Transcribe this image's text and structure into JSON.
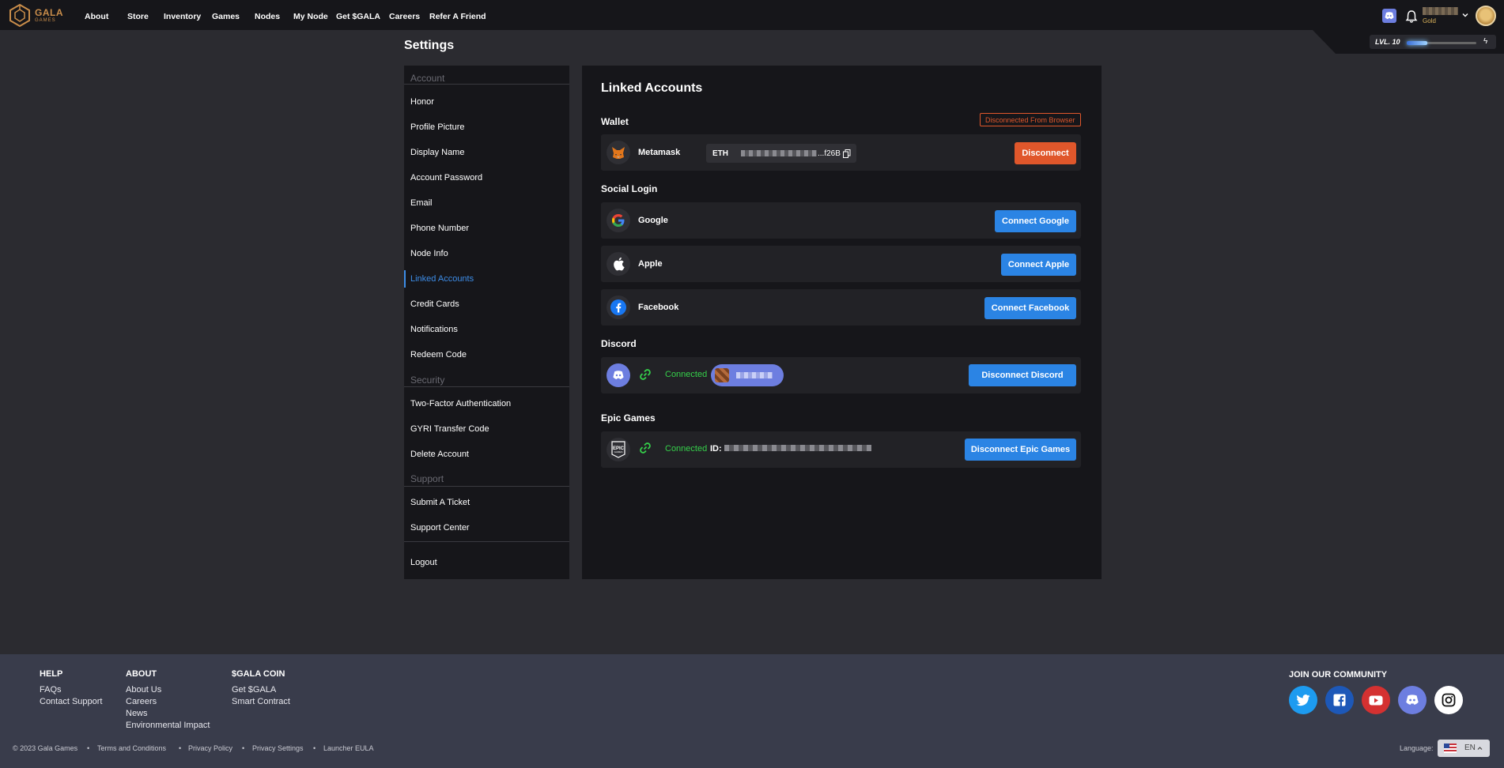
{
  "brand": {
    "name": "GALA",
    "sub": "GAMES"
  },
  "nav": [
    "About",
    "Store",
    "Inventory",
    "Games",
    "Nodes",
    "My Node",
    "Get $GALA",
    "Careers",
    "Refer A Friend"
  ],
  "user": {
    "tier": "Gold",
    "level_label": "LVL. 10",
    "level_progress": 0.3
  },
  "page_title": "Settings",
  "sidebar": {
    "sections": {
      "account": "Account",
      "security": "Security",
      "support": "Support"
    },
    "account_items": [
      "Honor",
      "Profile Picture",
      "Display Name",
      "Account Password",
      "Email",
      "Phone Number",
      "Node Info",
      "Linked Accounts",
      "Credit Cards",
      "Notifications",
      "Redeem Code"
    ],
    "security_items": [
      "Two-Factor Authentication",
      "GYRI Transfer Code",
      "Delete Account"
    ],
    "support_items": [
      "Submit A Ticket",
      "Support Center"
    ],
    "logout": "Logout",
    "active": "Linked Accounts"
  },
  "main": {
    "title": "Linked Accounts",
    "wallet": {
      "heading": "Wallet",
      "status_badge": "Disconnected From Browser",
      "name": "Metamask",
      "chain": "ETH",
      "address_suffix": "...f26B",
      "button": "Disconnect"
    },
    "social": {
      "heading": "Social Login",
      "items": [
        {
          "name": "Google",
          "button": "Connect Google"
        },
        {
          "name": "Apple",
          "button": "Connect Apple"
        },
        {
          "name": "Facebook",
          "button": "Connect Facebook"
        }
      ]
    },
    "discord": {
      "heading": "Discord",
      "status": "Connected",
      "button": "Disconnect Discord"
    },
    "epic": {
      "heading": "Epic Games",
      "status": "Connected",
      "id_label": "ID:",
      "button": "Disconnect Epic Games"
    }
  },
  "footer": {
    "columns": [
      {
        "heading": "HELP",
        "links": [
          "FAQs",
          "Contact Support"
        ]
      },
      {
        "heading": "ABOUT",
        "links": [
          "About Us",
          "Careers",
          "News",
          "Environmental Impact"
        ]
      },
      {
        "heading": "$GALA COIN",
        "links": [
          "Get $GALA",
          "Smart Contract"
        ]
      }
    ],
    "community_heading": "JOIN OUR COMMUNITY",
    "socials": [
      "twitter-icon",
      "facebook-icon",
      "youtube-icon",
      "discord-icon",
      "instagram-icon"
    ],
    "bottom_links": [
      "© 2023 Gala Games",
      "Terms and Conditions",
      "Privacy Policy",
      "Privacy Settings",
      "Launcher EULA"
    ],
    "language_label": "Language:",
    "language": "EN"
  },
  "colors": {
    "accent_blue": "#2b84e4",
    "accent_orange": "#e0572b",
    "connected_green": "#35d04a",
    "discord": "#6d7ee0"
  }
}
